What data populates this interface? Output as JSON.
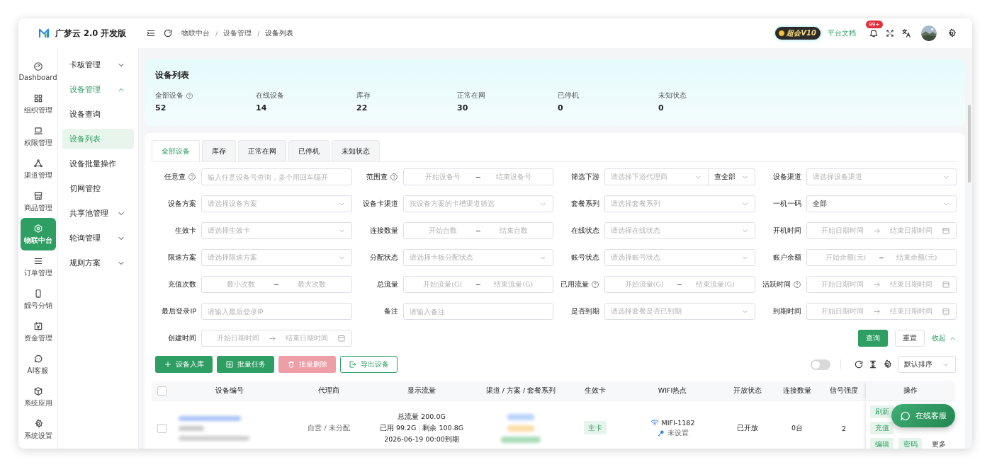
{
  "app": {
    "title": "广梦云 2.0 开发版"
  },
  "rail": [
    {
      "label": "Dashboard",
      "selected": false
    },
    {
      "label": "组织管理",
      "selected": false
    },
    {
      "label": "权限管理",
      "selected": false
    },
    {
      "label": "渠道管理",
      "selected": false
    },
    {
      "label": "商品管理",
      "selected": false
    },
    {
      "label": "物联中台",
      "selected": true
    },
    {
      "label": "订单管理",
      "selected": false
    },
    {
      "label": "靓号分销",
      "selected": false
    },
    {
      "label": "资金管理",
      "selected": false
    },
    {
      "label": "AI客服",
      "selected": false
    },
    {
      "label": "系统应用",
      "selected": false
    },
    {
      "label": "系统设置",
      "selected": false
    }
  ],
  "submenu": [
    {
      "label": "卡板管理",
      "expanded": false,
      "selected": false
    },
    {
      "label": "设备管理",
      "expanded": true,
      "selected": true,
      "children": [
        {
          "label": "设备查询",
          "selected": false
        },
        {
          "label": "设备列表",
          "selected": true
        },
        {
          "label": "设备批量操作",
          "selected": false
        },
        {
          "label": "切网管控",
          "selected": false
        }
      ]
    },
    {
      "label": "共享池管理",
      "expanded": false,
      "selected": false
    },
    {
      "label": "轮询管理",
      "expanded": false,
      "selected": false
    },
    {
      "label": "规则方案",
      "expanded": false,
      "selected": false
    }
  ],
  "header": {
    "breadcrumb": [
      "物联中台",
      "/",
      "设备管理",
      "/",
      "设备列表"
    ],
    "vip_badge": "超会V10",
    "docs_link": "平台文档",
    "notification_count": "99+"
  },
  "summary": {
    "title": "设备列表",
    "stats": [
      {
        "label": "全部设备",
        "value": "52",
        "help": true
      },
      {
        "label": "在线设备",
        "value": "14",
        "help": false
      },
      {
        "label": "库存",
        "value": "22",
        "help": false
      },
      {
        "label": "正常在网",
        "value": "30",
        "help": false
      },
      {
        "label": "已停机",
        "value": "0",
        "help": false
      },
      {
        "label": "未知状态",
        "value": "0",
        "help": false
      }
    ]
  },
  "tabs": [
    {
      "label": "全部设备",
      "selected": true
    },
    {
      "label": "库存",
      "selected": false
    },
    {
      "label": "正常在网",
      "selected": false
    },
    {
      "label": "已停机",
      "selected": false
    },
    {
      "label": "未知状态",
      "selected": false
    }
  ],
  "filters": [
    {
      "label": "任意查",
      "help": true,
      "kind": "text",
      "placeholder": "输入任意设备号查询，多个用回车隔开"
    },
    {
      "label": "范围查",
      "help": true,
      "kind": "range",
      "placeholders": [
        "开始设备号",
        "结束设备号"
      ]
    },
    {
      "label": "筛选下游",
      "help": false,
      "kind": "select_pair",
      "placeholder": "请选择下游代理商",
      "value": "查全部"
    },
    {
      "label": "设备渠道",
      "help": false,
      "kind": "select",
      "placeholder": "请选择设备渠道"
    },
    {
      "label": "设备方案",
      "help": false,
      "kind": "select",
      "placeholder": "请选择设备方案"
    },
    {
      "label": "设备卡渠道",
      "help": false,
      "kind": "select",
      "placeholder": "按设备方案的卡槽渠道筛选"
    },
    {
      "label": "套餐系列",
      "help": false,
      "kind": "select",
      "placeholder": "请选择套餐系列"
    },
    {
      "label": "一机一码",
      "help": false,
      "kind": "select",
      "value": "全部"
    },
    {
      "label": "生效卡",
      "help": false,
      "kind": "select",
      "placeholder": "请选择生效卡"
    },
    {
      "label": "连接数量",
      "help": false,
      "kind": "range",
      "placeholders": [
        "开始台数",
        "结束台数"
      ]
    },
    {
      "label": "在线状态",
      "help": false,
      "kind": "select",
      "placeholder": "请选择在线状态"
    },
    {
      "label": "开机时间",
      "help": false,
      "kind": "daterange",
      "placeholders": [
        "开始日期时间",
        "结束日期时间"
      ]
    },
    {
      "label": "限速方案",
      "help": false,
      "kind": "select",
      "placeholder": "请选择限速方案"
    },
    {
      "label": "分配状态",
      "help": false,
      "kind": "select",
      "placeholder": "请选择卡板分配状态"
    },
    {
      "label": "账号状态",
      "help": false,
      "kind": "select",
      "placeholder": "请选择账号状态"
    },
    {
      "label": "账户余额",
      "help": false,
      "kind": "range",
      "placeholders": [
        "开始余额(元)",
        "结束余额(元)"
      ]
    },
    {
      "label": "充值次数",
      "help": false,
      "kind": "range",
      "placeholders": [
        "最小次数",
        "最大次数"
      ]
    },
    {
      "label": "总流量",
      "help": false,
      "kind": "range",
      "placeholders": [
        "开始流量(G)",
        "结束流量(G)"
      ]
    },
    {
      "label": "已用流量",
      "help": true,
      "kind": "range",
      "placeholders": [
        "开始流量(G)",
        "结束流量(G)"
      ]
    },
    {
      "label": "活跃时间",
      "help": true,
      "kind": "daterange",
      "placeholders": [
        "开始日期时间",
        "结束日期时间"
      ]
    },
    {
      "label": "最后登录IP",
      "help": false,
      "kind": "text",
      "placeholder": "请输入最后登录IP"
    },
    {
      "label": "备注",
      "help": false,
      "kind": "text",
      "placeholder": "请输入备注"
    },
    {
      "label": "是否到期",
      "help": false,
      "kind": "select",
      "placeholder": "请选择套餐是否已到期"
    },
    {
      "label": "到期时间",
      "help": false,
      "kind": "daterange",
      "placeholders": [
        "开始日期时间",
        "结束日期时间"
      ]
    },
    {
      "label": "创建时间",
      "help": false,
      "kind": "daterange",
      "placeholders": [
        "开始日期时间",
        "结束日期时间"
      ]
    }
  ],
  "filter_actions": {
    "query": "查询",
    "reset": "重置",
    "collapse": "收起"
  },
  "toolbar": {
    "buttons": [
      {
        "label": "设备入库",
        "kind": "primary",
        "disabled": false
      },
      {
        "label": "批量任务",
        "kind": "primary",
        "disabled": false
      },
      {
        "label": "批量删除",
        "kind": "danger",
        "disabled": true
      },
      {
        "label": "导出设备",
        "kind": "outline",
        "disabled": false
      }
    ],
    "toggle_on": false,
    "sort": "默认排序"
  },
  "table": {
    "columns": [
      {
        "label": "设备编号",
        "kind": "device"
      },
      {
        "label": "代理商",
        "kind": "agent"
      },
      {
        "label": "显示流量",
        "kind": "flow"
      },
      {
        "label": "渠道 / 方案 / 套餐系列",
        "kind": "channel"
      },
      {
        "label": "生效卡",
        "kind": "card"
      },
      {
        "label": "WIFI热点",
        "kind": "wifi"
      },
      {
        "label": "开放状态",
        "kind": "open"
      },
      {
        "label": "连接数量",
        "kind": "connections"
      },
      {
        "label": "信号强度",
        "kind": "signal"
      },
      {
        "label": "操作",
        "kind": "actions"
      }
    ],
    "header_checked": false,
    "rows": [
      {
        "selected": false,
        "agent": "自营 / 未分配",
        "flow": {
          "total": "总流量 200.0G",
          "used": "已用 99.2G",
          "remaining": "剩余 100.8G",
          "expiry": "2026-06-19 00:00到期"
        },
        "channel_tags": [
          {
            "color": "#b9d3fb"
          },
          {
            "color": "#fbdca6"
          },
          {
            "color": "#a9dcb9"
          }
        ],
        "card": "主卡",
        "wifi_name": "MIFI-1182",
        "wifi_password": "未设置",
        "open": "已开放",
        "connections": "0台",
        "signal": "2",
        "action_rows": [
          [
            {
              "label": "刷新",
              "kind": "tag"
            }
          ],
          [
            {
              "label": "充值",
              "kind": "tag"
            }
          ],
          [
            {
              "label": "编辑",
              "kind": "tag"
            },
            {
              "label": "密码",
              "kind": "tag"
            },
            {
              "label": "更多",
              "kind": "link"
            }
          ]
        ]
      }
    ]
  },
  "chat_button": "在线客服"
}
